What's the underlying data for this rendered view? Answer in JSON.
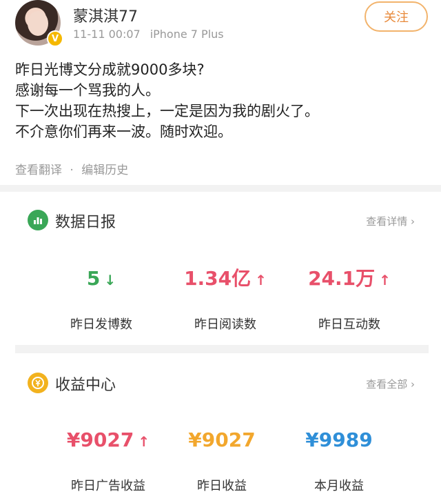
{
  "user": {
    "name": "蒙淇淇77",
    "timestamp": "11-11 00:07",
    "device": "iPhone 7 Plus",
    "verified_badge": "V"
  },
  "follow_label": "关注",
  "post": {
    "lines": [
      "昨日光博文分成就9000多块?",
      "感谢每一个骂我的人。",
      "下一次出现在热搜上，一定是因为我的剧火了。",
      "不介意你们再来一波。随时欢迎。"
    ],
    "translate_link": "查看翻译",
    "separator": "·",
    "history_link": "编辑历史"
  },
  "daily_report": {
    "title": "数据日报",
    "link": "查看详情 ›",
    "icon": "bar-chart-icon",
    "stats": [
      {
        "value": "5",
        "arrow": "↓",
        "label": "昨日发博数",
        "color": "#3aa757"
      },
      {
        "value": "1.34亿",
        "arrow": "↑",
        "label": "昨日阅读数",
        "color": "#e8506a"
      },
      {
        "value": "24.1万",
        "arrow": "↑",
        "label": "昨日互动数",
        "color": "#e8506a"
      }
    ]
  },
  "income_center": {
    "title": "收益中心",
    "link": "查看全部 ›",
    "icon": "coin-icon",
    "stats": [
      {
        "value": "¥9027",
        "arrow": "↑",
        "label": "昨日广告收益",
        "color": "#e8506a"
      },
      {
        "value": "¥9027",
        "arrow": "",
        "label": "昨日收益",
        "color": "#f2a72d"
      },
      {
        "value": "¥9989",
        "arrow": "",
        "label": "本月收益",
        "color": "#2f8fd8"
      }
    ]
  },
  "colors": {
    "follow_border": "#f2b36b",
    "follow_text": "#e8893a",
    "green": "#3aa757",
    "red": "#e8506a",
    "orange": "#f2a72d",
    "blue": "#2f8fd8"
  }
}
